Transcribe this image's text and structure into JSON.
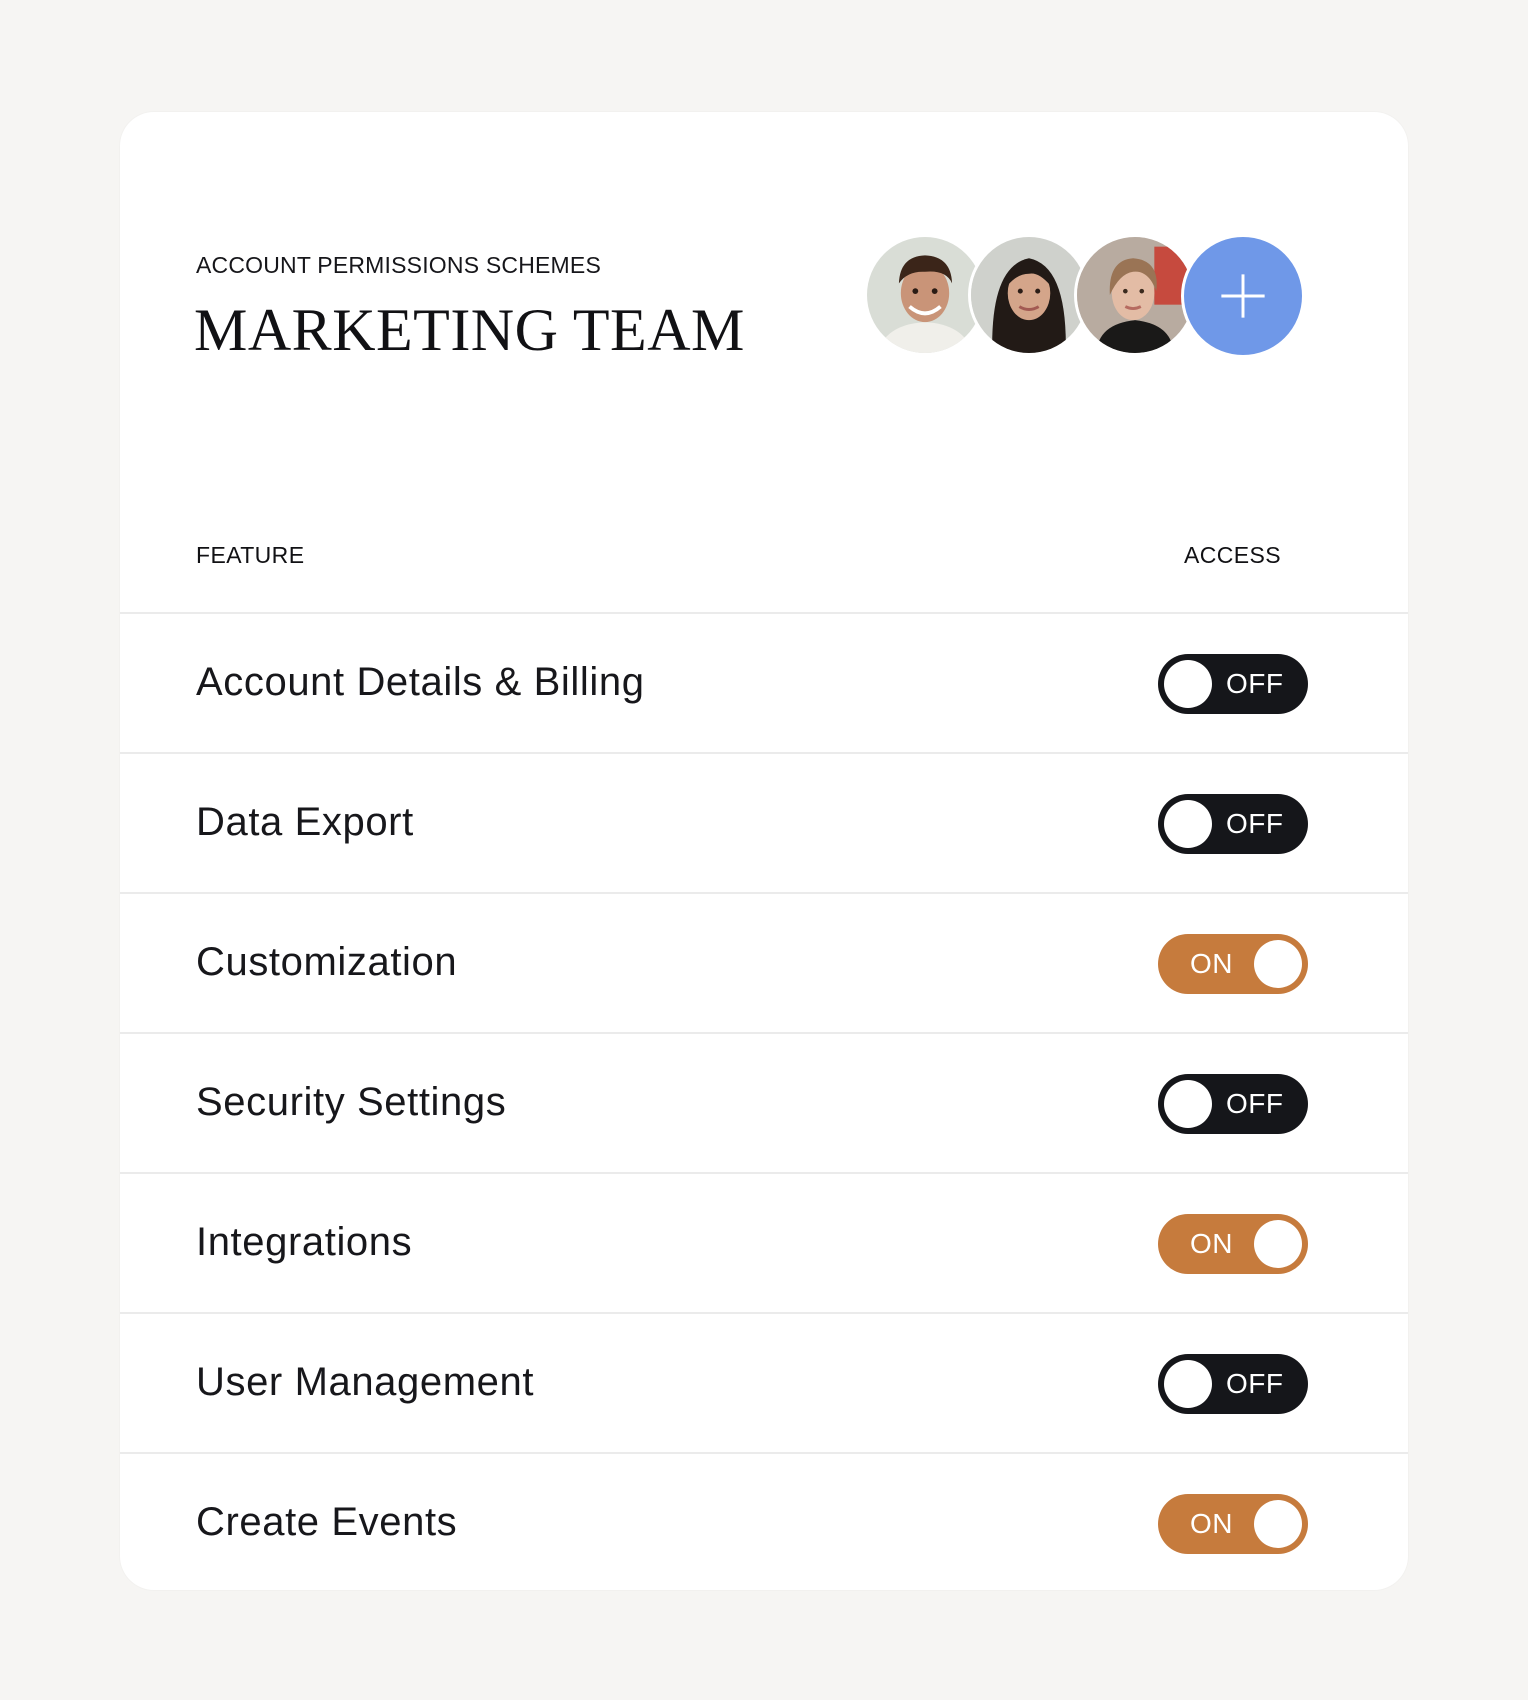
{
  "header": {
    "eyebrow": "ACCOUNT PERMISSIONS SCHEMES",
    "title": "MARKETING TEAM"
  },
  "team": {
    "members": [
      {
        "avatar": "avatar-man-curly-hair"
      },
      {
        "avatar": "avatar-woman-dark-hair"
      },
      {
        "avatar": "avatar-woman-light-hair"
      }
    ],
    "add_icon": "plus-icon",
    "add_color": "#6f98e8"
  },
  "table": {
    "feature_header": "FEATURE",
    "access_header": "ACCESS",
    "rows": [
      {
        "label": "Account Details & Billing",
        "state": "OFF"
      },
      {
        "label": "Data Export",
        "state": "OFF"
      },
      {
        "label": "Customization",
        "state": "ON"
      },
      {
        "label": "Security Settings",
        "state": "OFF"
      },
      {
        "label": "Integrations",
        "state": "ON"
      },
      {
        "label": "User Management",
        "state": "OFF"
      },
      {
        "label": "Create Events",
        "state": "ON"
      }
    ]
  },
  "colors": {
    "on": "#c67b3d",
    "off": "#15161a",
    "background": "#f6f5f3"
  }
}
